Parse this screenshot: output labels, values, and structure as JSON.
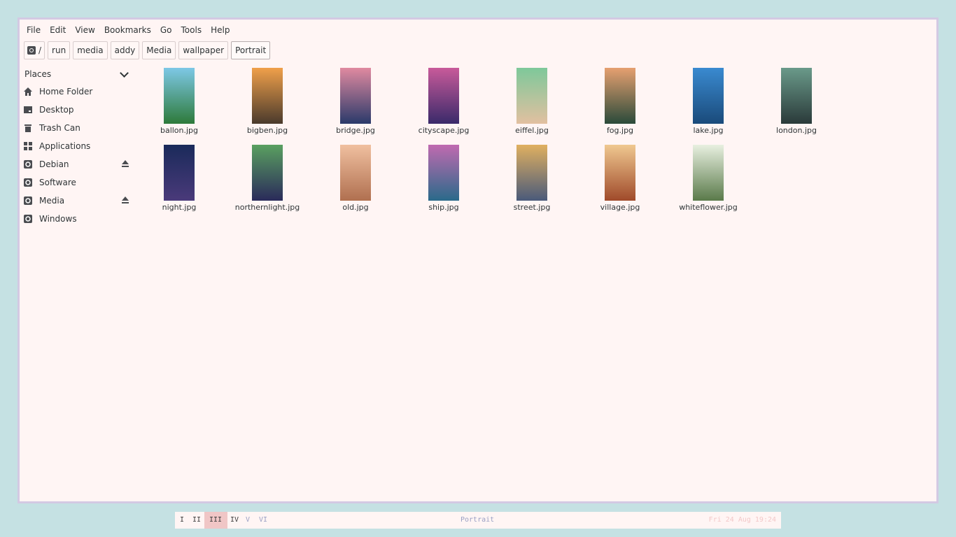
{
  "menu": [
    "File",
    "Edit",
    "View",
    "Bookmarks",
    "Go",
    "Tools",
    "Help"
  ],
  "path": [
    "/",
    "run",
    "media",
    "addy",
    "Media",
    "wallpaper",
    "Portrait"
  ],
  "sidebar": {
    "header": "Places",
    "items": [
      {
        "label": "Home Folder",
        "icon": "home-icon"
      },
      {
        "label": "Desktop",
        "icon": "desktop-icon"
      },
      {
        "label": "Trash Can",
        "icon": "trash-icon"
      },
      {
        "label": "Applications",
        "icon": "applications-icon"
      },
      {
        "label": "Debian",
        "icon": "drive-icon",
        "eject": true
      },
      {
        "label": "Software",
        "icon": "drive-icon"
      },
      {
        "label": "Media",
        "icon": "drive-icon",
        "eject": true
      },
      {
        "label": "Windows",
        "icon": "drive-icon"
      }
    ]
  },
  "files": [
    {
      "name": "ballon.jpg",
      "colors": [
        "#7ec8e6",
        "#2e7a3a"
      ]
    },
    {
      "name": "bigben.jpg",
      "colors": [
        "#f0a04a",
        "#4a3a2c"
      ]
    },
    {
      "name": "bridge.jpg",
      "colors": [
        "#e08aa0",
        "#2a3a6a"
      ]
    },
    {
      "name": "cityscape.jpg",
      "colors": [
        "#c85a9a",
        "#3a2a6a"
      ]
    },
    {
      "name": "eiffel.jpg",
      "colors": [
        "#7ec89a",
        "#e2c0a0"
      ]
    },
    {
      "name": "fog.jpg",
      "colors": [
        "#e6a070",
        "#2a4a3a"
      ]
    },
    {
      "name": "lake.jpg",
      "colors": [
        "#3a8ad0",
        "#1a4a7a"
      ]
    },
    {
      "name": "london.jpg",
      "colors": [
        "#6a9a8a",
        "#2a3a3a"
      ]
    },
    {
      "name": "night.jpg",
      "colors": [
        "#1a2a5a",
        "#4a3a7a"
      ]
    },
    {
      "name": "northernlight.jpg",
      "colors": [
        "#5aa060",
        "#2a2a5a"
      ]
    },
    {
      "name": "old.jpg",
      "colors": [
        "#f0c0a0",
        "#b07050"
      ]
    },
    {
      "name": "ship.jpg",
      "colors": [
        "#c06ab0",
        "#2a6a8a"
      ]
    },
    {
      "name": "street.jpg",
      "colors": [
        "#e0b060",
        "#4a5a7a"
      ]
    },
    {
      "name": "village.jpg",
      "colors": [
        "#f0c890",
        "#a04a2a"
      ]
    },
    {
      "name": "whiteflower.jpg",
      "colors": [
        "#e8f0e0",
        "#5a7a4a"
      ]
    }
  ],
  "status": {
    "workspaces": [
      "I",
      "II",
      "III",
      "IV",
      "V",
      "VI"
    ],
    "active": 2,
    "title": "Portrait",
    "clock": "Fri 24 Aug 19:24"
  }
}
